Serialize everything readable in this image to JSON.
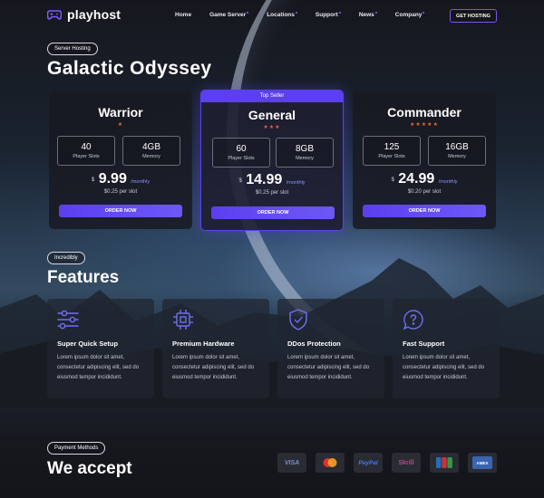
{
  "brand": {
    "name": "playhost"
  },
  "nav": {
    "links": [
      "Home",
      "Game Server",
      "Locations",
      "Support",
      "News",
      "Company"
    ],
    "cta": "GET HOSTING"
  },
  "hero": {
    "badge": "Server Hosting",
    "title": "Galactic Odyssey"
  },
  "plans": [
    {
      "name": "Warrior",
      "stars": "★",
      "slots": "40",
      "slots_label": "Player Slots",
      "memory": "4GB",
      "memory_label": "Memory",
      "currency": "$",
      "price": "9.99",
      "period": "/monthly",
      "per_slot": "$0.25 per slot",
      "cta": "ORDER NOW",
      "featured": false
    },
    {
      "name": "General",
      "stars": "★★★",
      "slots": "60",
      "slots_label": "Player Slots",
      "memory": "8GB",
      "memory_label": "Memory",
      "currency": "$",
      "price": "14.99",
      "period": "/monthly",
      "per_slot": "$0.25 per slot",
      "cta": "ORDER NOW",
      "featured": true,
      "ribbon": "Top Seller"
    },
    {
      "name": "Commander",
      "stars": "★★★★★",
      "slots": "125",
      "slots_label": "Player Slots",
      "memory": "16GB",
      "memory_label": "Memory",
      "currency": "$",
      "price": "24.99",
      "period": "/monthly",
      "per_slot": "$0.20 per slot",
      "cta": "ORDER NOW",
      "featured": false
    }
  ],
  "features": {
    "badge": "Incredibly",
    "title": "Features",
    "items": [
      {
        "title": "Super Quick Setup",
        "desc": "Lorem ipsum dolor sit amet, consectetur adipiscing elit, sed do eiusmod tempor incididunt.",
        "icon": "sliders-icon"
      },
      {
        "title": "Premium Hardware",
        "desc": "Lorem ipsum dolor sit amet, consectetur adipiscing elit, sed do eiusmod tempor incididunt.",
        "icon": "chip-icon"
      },
      {
        "title": "DDos Protection",
        "desc": "Lorem ipsum dolor sit amet, consectetur adipiscing elit, sed do eiusmod tempor incididunt.",
        "icon": "shield-icon"
      },
      {
        "title": "Fast Support",
        "desc": "Lorem ipsum dolor sit amet, consectetur adipiscing elit, sed do eiusmod tempor incididunt.",
        "icon": "chat-question-icon"
      }
    ]
  },
  "payments": {
    "badge": "Payment Methods",
    "title": "We accept",
    "methods": [
      "VISA",
      "mastercard",
      "PayPal",
      "Skrill",
      "JCB",
      "AMEX"
    ]
  },
  "colors": {
    "accent": "#5b3ff0",
    "star": "#e8652f",
    "background": "#15161c"
  }
}
